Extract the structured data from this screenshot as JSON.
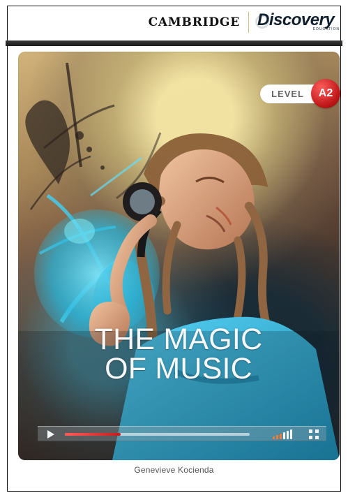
{
  "brand": {
    "cambridge": "CAMBRIDGE",
    "discovery": "Discovery",
    "discovery_sub": "EDUCATION"
  },
  "badge": {
    "level_label": "LEVEL",
    "level_code": "A2",
    "badge_color": "#c3191a"
  },
  "cover": {
    "title_line_1": "THE MAGIC",
    "title_line_2": "OF MUSIC",
    "author": "Genevieve Kocienda",
    "accent_blue": "#28c6f1",
    "frame_color": "#222222"
  },
  "player": {
    "progress": 0.3,
    "play_icon": "play-icon",
    "volume_icon": "volume-icon",
    "fullscreen_icon": "fullscreen-icon"
  }
}
